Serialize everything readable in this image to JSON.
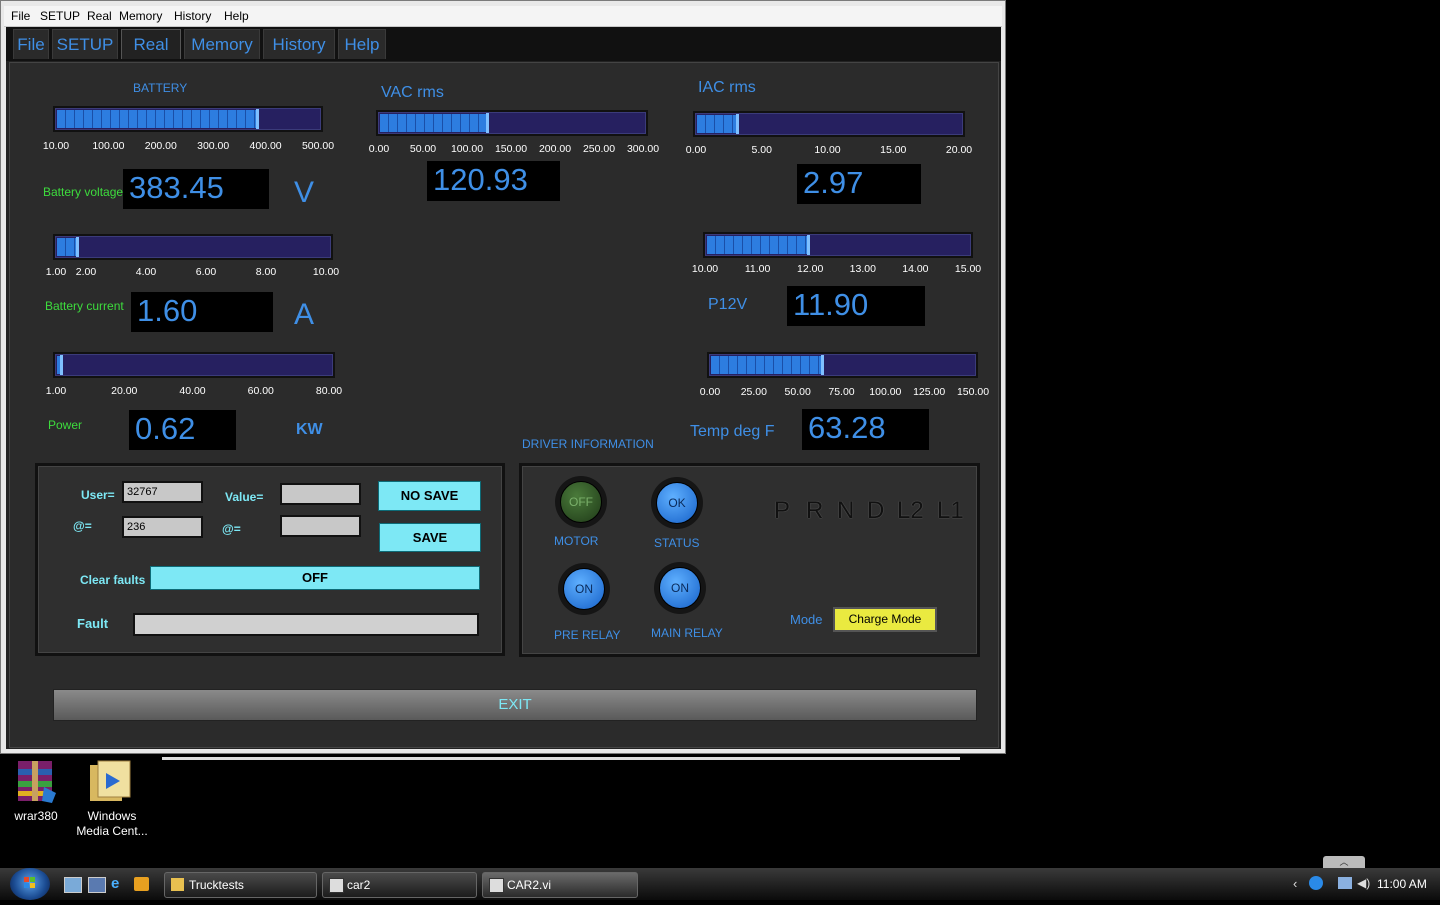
{
  "menu": [
    "File",
    "SETUP",
    "Real",
    "Memory",
    "History",
    "Help"
  ],
  "tabs": [
    "File",
    "SETUP",
    "Real",
    "Memory",
    "History",
    "Help"
  ],
  "battery": {
    "title": "BATTERY",
    "voltage_label": "Battery voltage",
    "voltage_value": "383.45",
    "voltage_unit": "V",
    "voltage_fraction": 0.76,
    "voltage_ticks": [
      "10.00",
      "100.00",
      "200.00",
      "300.00",
      "400.00",
      "500.00"
    ],
    "current_label": "Battery current",
    "current_value": "1.60",
    "current_unit": "A",
    "current_fraction": 0.07,
    "current_ticks": [
      "1.00",
      "2.00",
      "4.00",
      "6.00",
      "8.00",
      "10.00"
    ],
    "power_label": "Power",
    "power_value": "0.62",
    "power_unit": "KW",
    "power_fraction": 0.005,
    "power_ticks": [
      "1.00",
      "20.00",
      "40.00",
      "60.00",
      "80.00"
    ]
  },
  "vac": {
    "title": "VAC rms",
    "value": "120.93",
    "fraction": 0.4,
    "ticks": [
      "0.00",
      "50.00",
      "100.00",
      "150.00",
      "200.00",
      "250.00",
      "300.00"
    ]
  },
  "iac": {
    "title": "IAC rms",
    "value": "2.97",
    "fraction": 0.148,
    "ticks": [
      "0.00",
      "5.00",
      "10.00",
      "15.00",
      "20.00"
    ]
  },
  "p12v": {
    "label": "P12V",
    "value": "11.90",
    "fraction": 0.38,
    "ticks": [
      "10.00",
      "11.00",
      "12.00",
      "13.00",
      "14.00",
      "15.00"
    ]
  },
  "temp": {
    "label": "Temp deg F",
    "value": "63.28",
    "fraction": 0.42,
    "ticks": [
      "0.00",
      "25.00",
      "50.00",
      "75.00",
      "100.00",
      "125.00",
      "150.00"
    ]
  },
  "memory_panel": {
    "user_label": "User=",
    "user_value": "32767",
    "addr_label": "@=",
    "addr_value": "236",
    "value_label": "Value=",
    "value_value": "",
    "addr2_label": "@=",
    "addr2_value": "",
    "no_save_label": "NO SAVE",
    "save_label": "SAVE",
    "clear_faults_label": "Clear faults",
    "clear_faults_value": "OFF",
    "fault_label": "Fault",
    "fault_value": ""
  },
  "driver": {
    "title": "DRIVER INFORMATION",
    "motor_label": "MOTOR",
    "motor_state": "OFF",
    "status_label": "STATUS",
    "status_state": "OK",
    "pre_relay_label": "PRE RELAY",
    "pre_relay_state": "ON",
    "main_relay_label": "MAIN RELAY",
    "main_relay_state": "ON",
    "gears": [
      "P",
      "R",
      "N",
      "D",
      "L2",
      "L1"
    ],
    "mode_label": "Mode",
    "mode_value": "Charge Mode"
  },
  "exit_label": "EXIT",
  "desktop": [
    {
      "name": "wrar380"
    },
    {
      "name": "Windows Media Cent..."
    }
  ],
  "taskbar": {
    "buttons": [
      "Trucktests",
      "car2",
      "CAR2.vi"
    ],
    "clock": "11:00 AM"
  },
  "colors": {
    "accent_blue": "#3f8fe6",
    "green_label": "#3ddc3d",
    "cyan_label": "#7de8f5",
    "mode_yellow": "#eaea40"
  }
}
